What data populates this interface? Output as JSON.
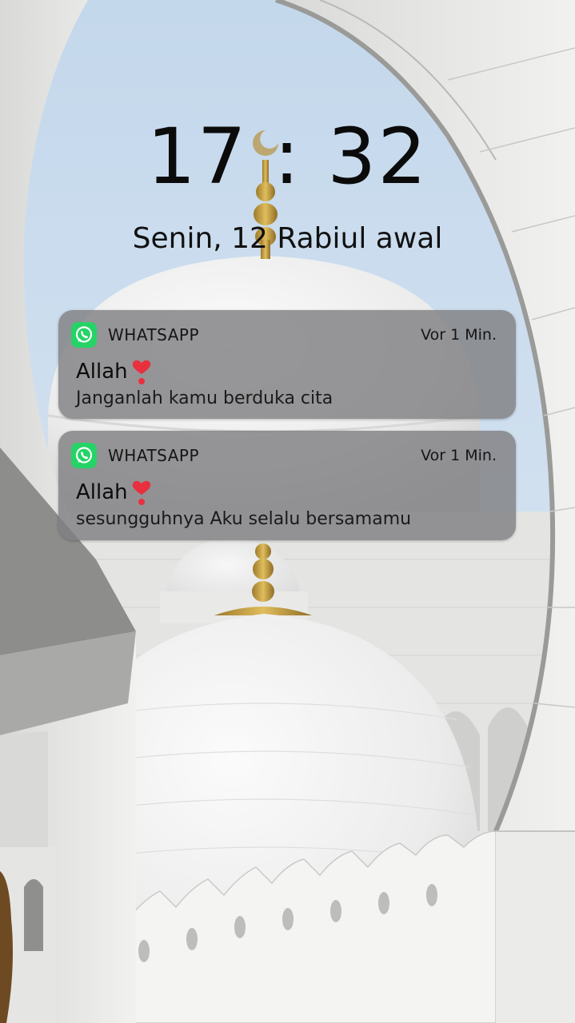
{
  "lockscreen": {
    "time": "17 : 32",
    "date": "Senin, 12 Rabiul awal"
  },
  "notifications": [
    {
      "app": "WHATSAPP",
      "app_icon": "whatsapp-icon",
      "time_ago": "Vor 1 Min.",
      "title": "Allah",
      "title_emoji": "heart-exclamation-icon",
      "body": "Janganlah kamu berduka cita"
    },
    {
      "app": "WHATSAPP",
      "app_icon": "whatsapp-icon",
      "time_ago": "Vor 1 Min.",
      "title": "Allah",
      "title_emoji": "heart-exclamation-icon",
      "body": "sesungguhnya Aku selalu bersamamu"
    }
  ],
  "colors": {
    "whatsapp_green": "#25D366",
    "heart_red": "#e8303f",
    "notification_bg": "#808082"
  }
}
